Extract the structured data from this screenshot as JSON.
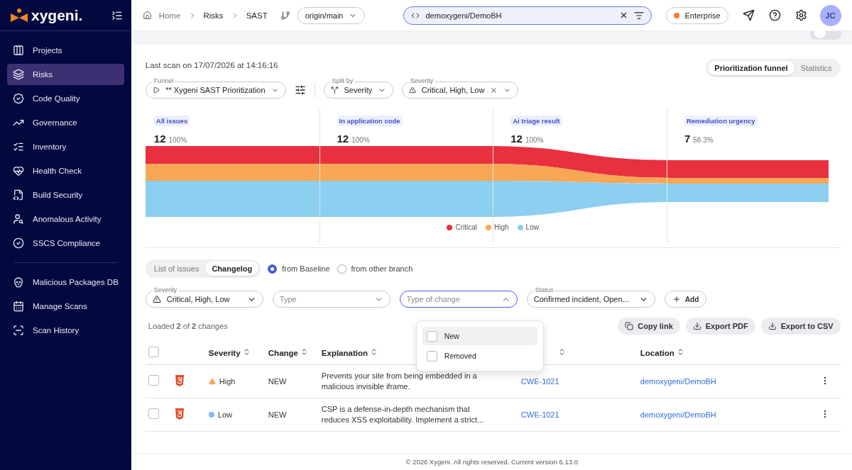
{
  "brand": {
    "name": "xygeni."
  },
  "sidebar": {
    "items": [
      {
        "label": "Projects",
        "selected": false
      },
      {
        "label": "Risks",
        "selected": true
      },
      {
        "label": "Code Quality",
        "selected": false
      },
      {
        "label": "Governance",
        "selected": false
      },
      {
        "label": "Inventory",
        "selected": false
      },
      {
        "label": "Health Check",
        "selected": false
      },
      {
        "label": "Build Security",
        "selected": false
      },
      {
        "label": "Anomalous Activity",
        "selected": false
      },
      {
        "label": "SSCS Compliance",
        "selected": false
      }
    ],
    "tools": [
      {
        "label": "Malicious Packages DB",
        "selected": false
      },
      {
        "label": "Manage Scans",
        "selected": false
      },
      {
        "label": "Scan History",
        "selected": false
      }
    ]
  },
  "breadcrumb": [
    "Home",
    "Risks",
    "SAST"
  ],
  "branch": "origin/main",
  "project_search": {
    "value": "demoxygeni/DemoBH"
  },
  "plan": {
    "label": "Enterprise",
    "color": "#f5793b"
  },
  "avatar": "JC",
  "remediation_view": {
    "on": false
  },
  "last_scan": "Last scan on 17/07/2026 at 14:16:16",
  "view_tabs": [
    {
      "label": "Prioritization funnel",
      "selected": true
    },
    {
      "label": "Statistics",
      "selected": false
    }
  ],
  "filters": [
    {
      "kind": "funnel",
      "legend": "Funnel",
      "value": "** Xygeni SAST Prioritization"
    },
    {
      "kind": "split",
      "legend": "Split by",
      "value": "Severity"
    },
    {
      "kind": "severity",
      "legend": "Severity",
      "value": "Critical, High, Low"
    }
  ],
  "funnel": {
    "stages": [
      {
        "label": "All issues",
        "count": "12",
        "percent": "100%"
      },
      {
        "label": "In application code",
        "count": "12",
        "percent": "100%"
      },
      {
        "label": "Ai triage result",
        "count": "12",
        "percent": "100%"
      },
      {
        "label": "Remediation urgency",
        "count": "7",
        "percent": "58.3%"
      }
    ],
    "legend": [
      {
        "label": "Critical",
        "color": "#e8303f"
      },
      {
        "label": "High",
        "color": "#f9a655"
      },
      {
        "label": "Low",
        "color": "#8ccff0"
      }
    ]
  },
  "list_tabs": [
    {
      "label": "List of issues",
      "selected": false
    },
    {
      "label": "Changelog",
      "selected": true
    }
  ],
  "compare": [
    {
      "label": "from Baseline",
      "selected": true
    },
    {
      "label": "from other branch",
      "selected": false
    }
  ],
  "list_filters": [
    {
      "kind": "severity",
      "legend": "Severity",
      "value": "Critical, High, Low"
    },
    {
      "kind": "empty",
      "placeholder": "Type"
    },
    {
      "kind": "open",
      "placeholder": "Type of change"
    },
    {
      "kind": "status",
      "legend": "Status",
      "value": "Confirmed incident, Open..."
    }
  ],
  "add_button": "Add",
  "loaded": "Loaded **2** of **2** changes",
  "actions": [
    "Copy link",
    "Export PDF",
    "Export to CSV"
  ],
  "change_menu": [
    {
      "label": "New",
      "checked": false
    },
    {
      "label": "Removed",
      "checked": false
    }
  ],
  "table": {
    "select_all": {
      "checked": false
    },
    "columns": [
      "Severity",
      "Change",
      "Explanation",
      "Location"
    ],
    "rows": [
      {
        "checked": false,
        "severity": "High",
        "color": "#f9a655",
        "change": "NEW",
        "explanation": "Prevents your site from being embedded in a malicious invisible iframe.",
        "cwe": "CWE-1021",
        "location": "demoxygeni/DemoBH"
      },
      {
        "checked": false,
        "severity": "Low",
        "color": "#8ab8f5",
        "change": "NEW",
        "explanation": "CSP is a defense-in-depth mechanism that reduces XSS exploitability. Implement a strict...",
        "cwe": "CWE-1021",
        "location": "demoxygeni/DemoBH"
      }
    ]
  },
  "footer": "© 2026 Xygeni. All rights reserved. Current version 6.13.0"
}
